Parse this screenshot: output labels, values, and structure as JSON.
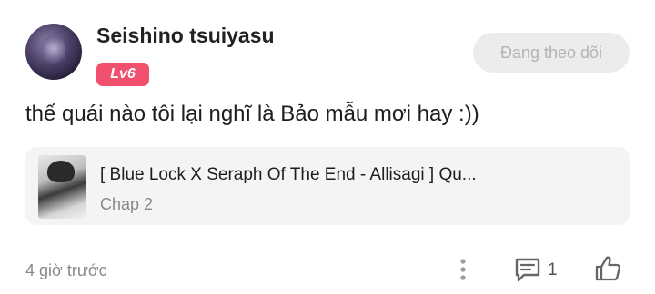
{
  "comment": {
    "username": "Seishino tsuiyasu",
    "level_badge": "Lv6",
    "follow_button_label": "Đang theo dõi",
    "text": "thế quái nào tôi lại nghĩ là Bảo mẫu mơi hay :))",
    "manga": {
      "title": "[ Blue Lock X Seraph Of The End - Allisagi ] Qu...",
      "chapter": "Chap 2"
    },
    "timestamp": "4 giờ trước",
    "reply_count": "1",
    "icons": {
      "more": "more-vertical-icon",
      "reply": "comment-icon",
      "like": "thumbs-up-icon"
    },
    "colors": {
      "badge": "#f0506e",
      "follow_button_bg": "#ececec",
      "card_bg": "#f4f4f4"
    }
  }
}
